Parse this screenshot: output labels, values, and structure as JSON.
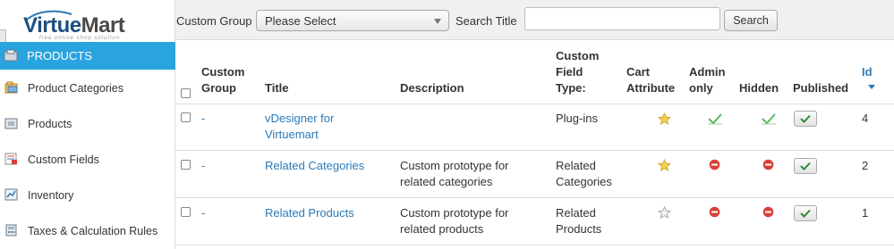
{
  "logo": {
    "name_part1": "Virtue",
    "name_part2": "Mart",
    "tagline": "free online shop solution"
  },
  "sidebar": {
    "active": {
      "label": "PRODUCTS",
      "icon": "products-icon"
    },
    "items": [
      {
        "label": "Product Categories",
        "icon": "folders-icon"
      },
      {
        "label": "Products",
        "icon": "product-box-icon"
      },
      {
        "label": "Custom Fields",
        "icon": "custom-fields-icon"
      },
      {
        "label": "Inventory",
        "icon": "inventory-icon"
      },
      {
        "label": "Taxes & Calculation Rules",
        "icon": "calculator-icon"
      }
    ]
  },
  "filter": {
    "custom_group_label": "Custom Group",
    "select_value": "Please Select",
    "search_title_label": "Search Title",
    "search_value": "",
    "search_button": "Search"
  },
  "table": {
    "headers": {
      "custom_group": "Custom Group",
      "title": "Title",
      "description": "Description",
      "field_type": "Custom Field Type:",
      "cart_attribute": "Cart Attribute",
      "admin_only": "Admin only",
      "hidden": "Hidden",
      "published": "Published",
      "id": "Id"
    },
    "rows": [
      {
        "group": "-",
        "title_line1": "vDesigner for",
        "title_line2": "Virtuemart",
        "desc_line1": "",
        "desc_line2": "",
        "type_line1": "Plug-ins",
        "type_line2": "",
        "cart_attribute": "star-filled",
        "admin_only": "check",
        "hidden": "check",
        "published": true,
        "id": "4"
      },
      {
        "group": "-",
        "title_line1": "Related Categories",
        "title_line2": "",
        "desc_line1": "Custom prototype for",
        "desc_line2": "related categories",
        "type_line1": "Related",
        "type_line2": "Categories",
        "cart_attribute": "star-filled",
        "admin_only": "no",
        "hidden": "no",
        "published": true,
        "id": "2"
      },
      {
        "group": "-",
        "title_line1": "Related Products",
        "title_line2": "",
        "desc_line1": "Custom prototype for",
        "desc_line2": "related products",
        "type_line1": "Related",
        "type_line2": "Products",
        "cart_attribute": "star-empty",
        "admin_only": "no",
        "hidden": "no",
        "published": true,
        "id": "1"
      }
    ]
  },
  "colors": {
    "accent": "#2aa4df",
    "link": "#2a7ab8",
    "check": "#5cb85c",
    "red": "#d9403a",
    "star": "#f0c419"
  }
}
